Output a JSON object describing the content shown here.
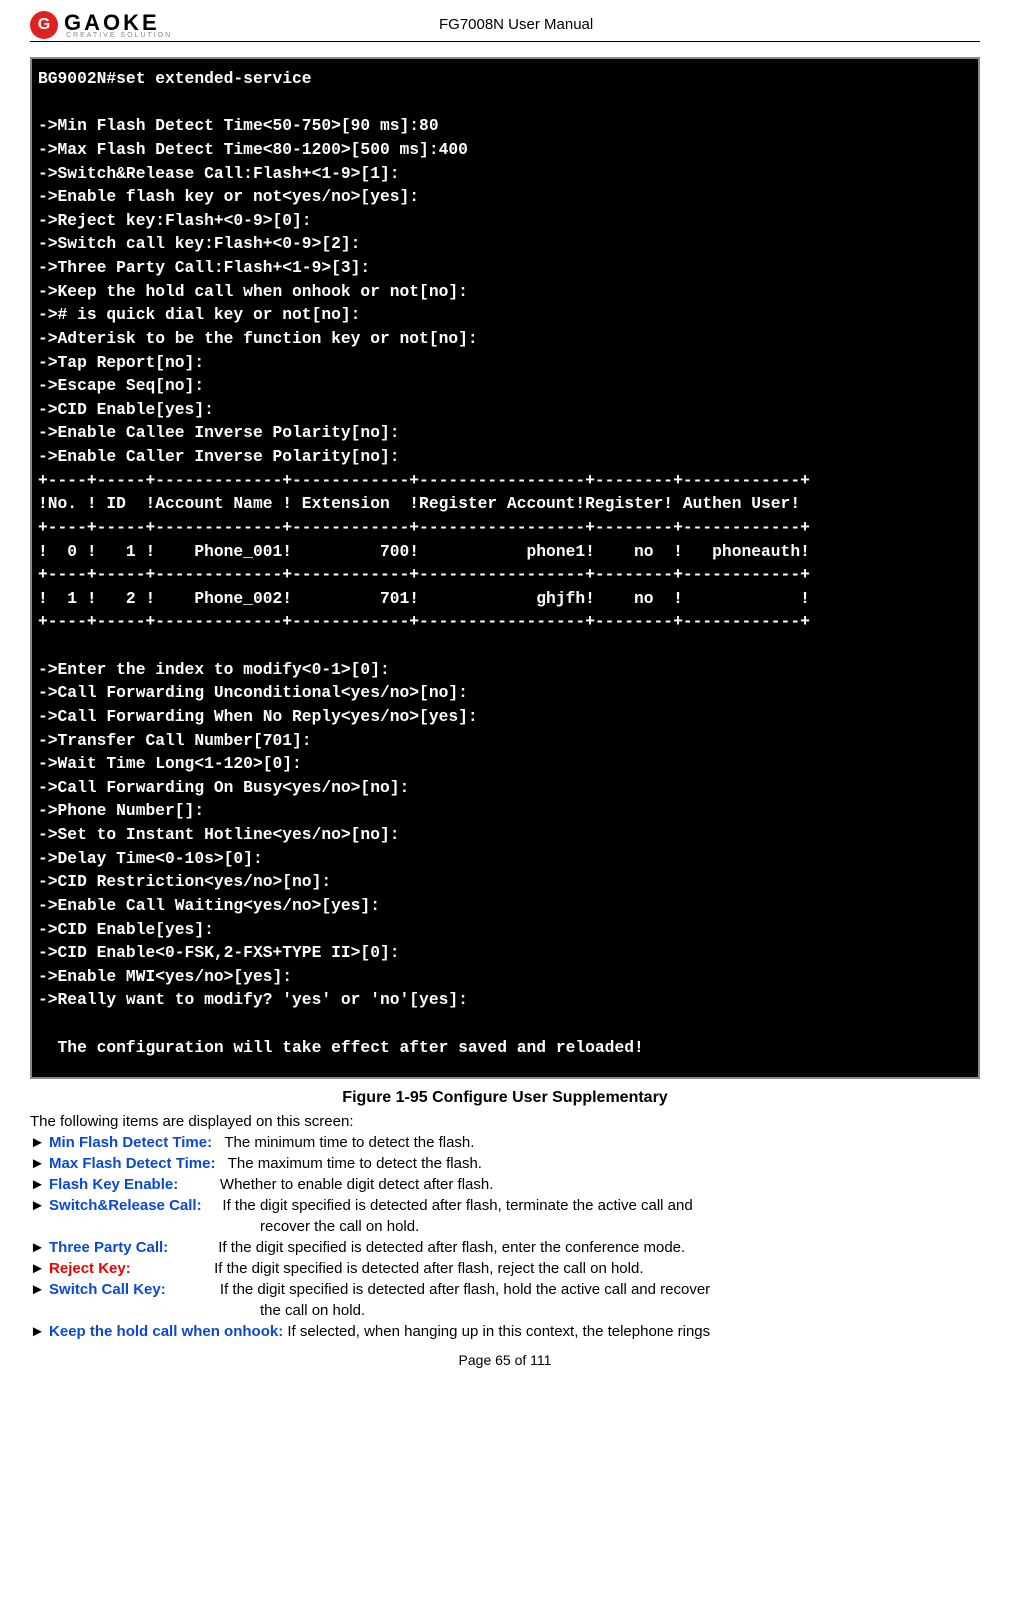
{
  "header": {
    "brand": "GAOKE",
    "tagline": "CREATIVE SOLUTION",
    "docTitle": "FG7008N User Manual"
  },
  "terminal": {
    "content": "BG9002N#set extended-service\n\n->Min Flash Detect Time<50-750>[90 ms]:80\n->Max Flash Detect Time<80-1200>[500 ms]:400\n->Switch&Release Call:Flash+<1-9>[1]:\n->Enable flash key or not<yes/no>[yes]:\n->Reject key:Flash+<0-9>[0]:\n->Switch call key:Flash+<0-9>[2]:\n->Three Party Call:Flash+<1-9>[3]:\n->Keep the hold call when onhook or not[no]:\n-># is quick dial key or not[no]:\n->Adterisk to be the function key or not[no]:\n->Tap Report[no]:\n->Escape Seq[no]:\n->CID Enable[yes]:\n->Enable Callee Inverse Polarity[no]:\n->Enable Caller Inverse Polarity[no]:\n+----+-----+-------------+------------+-----------------+--------+------------+\n!No. ! ID  !Account Name ! Extension  !Register Account!Register! Authen User!\n+----+-----+-------------+------------+-----------------+--------+------------+\n!  0 !   1 !    Phone_001!         700!           phone1!    no  !   phoneauth!\n+----+-----+-------------+------------+-----------------+--------+------------+\n!  1 !   2 !    Phone_002!         701!            ghjfh!    no  !            !\n+----+-----+-------------+------------+-----------------+--------+------------+\n\n->Enter the index to modify<0-1>[0]:\n->Call Forwarding Unconditional<yes/no>[no]:\n->Call Forwarding When No Reply<yes/no>[yes]:\n->Transfer Call Number[701]:\n->Wait Time Long<1-120>[0]:\n->Call Forwarding On Busy<yes/no>[no]:\n->Phone Number[]:\n->Set to Instant Hotline<yes/no>[no]:\n->Delay Time<0-10s>[0]:\n->CID Restriction<yes/no>[no]:\n->Enable Call Waiting<yes/no>[yes]:\n->CID Enable[yes]:\n->CID Enable<0-FSK,2-FXS+TYPE II>[0]:\n->Enable MWI<yes/no>[yes]:\n->Really want to modify? 'yes' or 'no'[yes]:\n\n  The configuration will take effect after saved and reloaded!"
  },
  "figure": {
    "caption": "Figure 1-95   Configure User Supplementary"
  },
  "intro": "The following items are displayed on this screen:",
  "items": [
    {
      "arrow": "►",
      "term": "Min Flash Detect Time:",
      "redTerm": "",
      "desc": "   The minimum time to detect the flash.",
      "cont": ""
    },
    {
      "arrow": "►",
      "term": "Max Flash Detect Time:",
      "redTerm": "",
      "desc": "   The maximum time to detect the flash.",
      "cont": ""
    },
    {
      "arrow": "►",
      "term": "Flash Key Enable:",
      "redTerm": "",
      "desc": "          Whether to enable digit detect after flash.",
      "cont": ""
    },
    {
      "arrow": "►",
      "term": "Switch&Release Call:",
      "redTerm": "",
      "desc": "     If the digit specified is detected after flash, terminate the active call and",
      "cont": "recover the call on hold."
    },
    {
      "arrow": "►",
      "term": "Three Party Call:",
      "redTerm": "",
      "desc": "            If the digit specified is detected after flash, enter the conference mode.",
      "cont": ""
    },
    {
      "arrow": "►",
      "term": "",
      "redTerm": "Reject Key:",
      "desc": "                    If the digit specified is detected after flash, reject the call on hold.",
      "cont": ""
    },
    {
      "arrow": "►",
      "term": "Switch Call Key:",
      "redTerm": "",
      "desc": "             If the digit specified is detected after flash, hold the active call and recover",
      "cont": "the call on hold."
    },
    {
      "arrow": "►",
      "term": "Keep the hold call when onhook:",
      "redTerm": "",
      "desc": " If selected, when hanging up in this context, the telephone rings",
      "cont": ""
    }
  ],
  "footer": {
    "pageInfo": "Page 65 of 111"
  }
}
